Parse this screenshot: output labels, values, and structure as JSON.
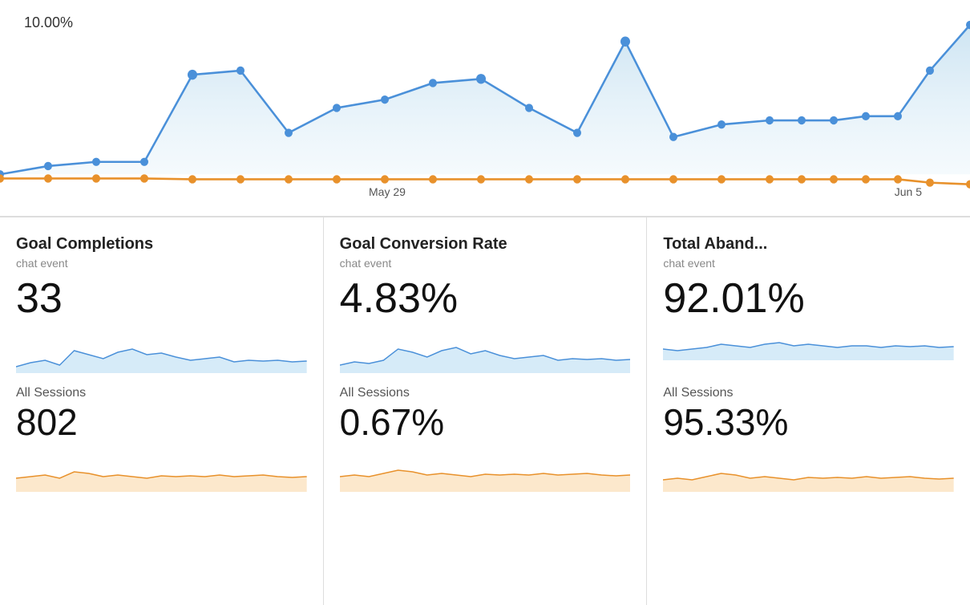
{
  "chart": {
    "percent_label": "10.00%",
    "date_may": "May 29",
    "date_jun": "Jun 5"
  },
  "cards": [
    {
      "title": "Goal Completions",
      "subtitle": "chat event",
      "value": "33",
      "session_label": "All Sessions",
      "session_value": "802"
    },
    {
      "title": "Goal Conversion Rate",
      "subtitle": "chat event",
      "value": "4.83%",
      "session_label": "All Sessions",
      "session_value": "0.67%"
    },
    {
      "title": "Total Aband...",
      "subtitle": "chat event",
      "value": "92.01%",
      "session_label": "All Sessions",
      "session_value": "95.33%"
    }
  ]
}
